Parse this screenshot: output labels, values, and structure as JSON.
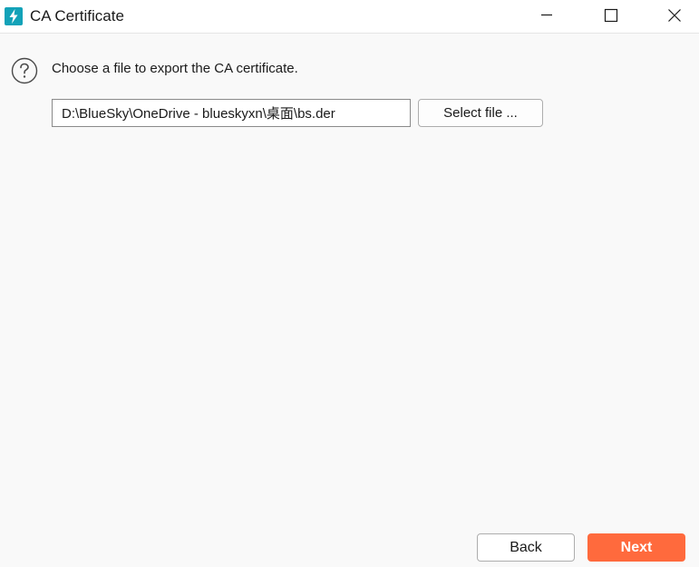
{
  "window": {
    "title": "CA Certificate",
    "icon": "lightning-bolt-icon",
    "controls": {
      "minimize": "minimize-icon",
      "maximize": "maximize-icon",
      "close": "close-icon"
    }
  },
  "content": {
    "help_icon": "question-circle-icon",
    "prompt": "Choose a file to export the CA certificate.",
    "file_path": {
      "value": "D:\\BlueSky\\OneDrive - blueskyxn\\桌面\\bs.der",
      "placeholder": ""
    },
    "select_file_label": "Select file ..."
  },
  "footer": {
    "back_label": "Back",
    "next_label": "Next"
  },
  "colors": {
    "accent": "#ff6a3d",
    "app_icon": "#13a2b8",
    "background": "#f9f9f9"
  }
}
